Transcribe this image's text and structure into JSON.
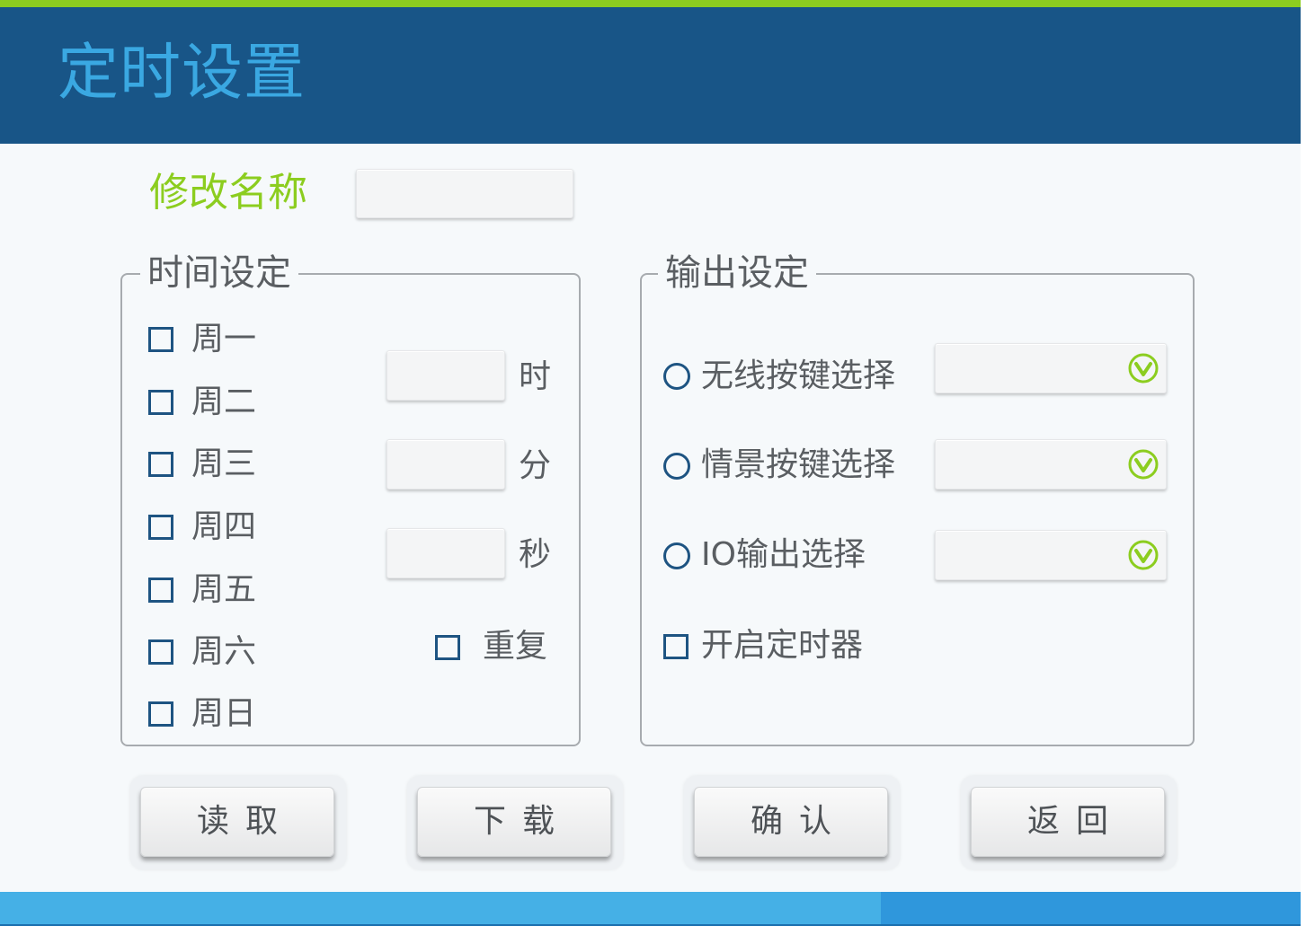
{
  "header": {
    "title": "定时设置"
  },
  "rename": {
    "label": "修改名称",
    "value": ""
  },
  "time_settings": {
    "legend": "时间设定",
    "days": [
      {
        "label": "周一",
        "checked": false
      },
      {
        "label": "周二",
        "checked": false
      },
      {
        "label": "周三",
        "checked": false
      },
      {
        "label": "周四",
        "checked": false
      },
      {
        "label": "周五",
        "checked": false
      },
      {
        "label": "周六",
        "checked": false
      },
      {
        "label": "周日",
        "checked": false
      }
    ],
    "hour": {
      "unit": "时",
      "value": ""
    },
    "minute": {
      "unit": "分",
      "value": ""
    },
    "second": {
      "unit": "秒",
      "value": ""
    },
    "repeat": {
      "label": "重复",
      "checked": false
    }
  },
  "output_settings": {
    "legend": "输出设定",
    "options": [
      {
        "label": "无线按键选择",
        "selected": false,
        "dropdown_value": ""
      },
      {
        "label": "情景按键选择",
        "selected": false,
        "dropdown_value": ""
      },
      {
        "label": "IO输出选择",
        "selected": false,
        "dropdown_value": ""
      }
    ],
    "enable_timer": {
      "label": "开启定时器",
      "checked": false
    }
  },
  "buttons": {
    "read": "读取",
    "download": "下载",
    "confirm": "确认",
    "back": "返回"
  },
  "icons": {
    "dropdown": "chevron-down-circle-icon"
  },
  "colors": {
    "header_bg": "#185587",
    "title": "#3aa8e2",
    "accent_green": "#8ccd1f",
    "checkbox_border": "#1e5482",
    "bottom_bar": "#45b0e6"
  }
}
